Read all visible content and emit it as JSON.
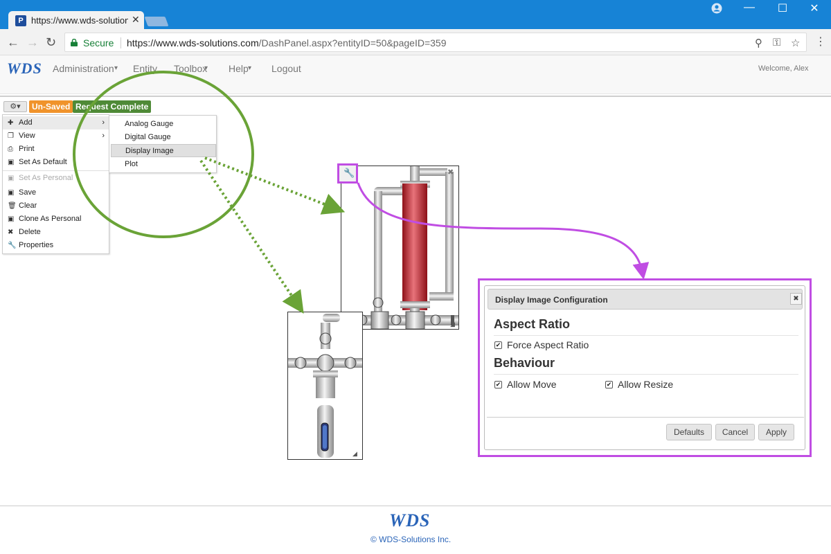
{
  "browser": {
    "tab_title": "https://www.wds-solution",
    "tab_close": "✕",
    "favicon_letter": "P",
    "secure_label": "Secure",
    "url_main": "https://www.wds-solutions.com",
    "url_path": "/DashPanel.aspx?entityID=50&pageID=359",
    "window_controls": {
      "minimize": "—",
      "maximize": "☐",
      "close": "✕"
    }
  },
  "app_nav": {
    "logo": "WDS",
    "items": [
      "Administration",
      "Entity",
      "Toolbox",
      "Help",
      "Logout"
    ],
    "dropdown_flags": [
      true,
      false,
      true,
      true,
      false
    ],
    "welcome": "Welcome, Alex"
  },
  "status": {
    "unsaved": "Un-Saved",
    "request_complete": "Request Complete"
  },
  "context_menu": {
    "items": [
      {
        "label": "Add",
        "icon": "plus-icon",
        "glyph": "✚",
        "submenu": true
      },
      {
        "label": "View",
        "icon": "window-icon",
        "glyph": "❐",
        "submenu": true
      },
      {
        "label": "Print",
        "icon": "print-icon",
        "glyph": "⎙"
      },
      {
        "label": "Set As Default",
        "icon": "save-icon",
        "glyph": "▣"
      },
      {
        "label": "Set As Personal",
        "icon": "save-icon",
        "glyph": "▣",
        "disabled": true
      },
      {
        "label": "Save",
        "icon": "save-icon",
        "glyph": "▣"
      },
      {
        "label": "Clear",
        "icon": "trash-icon",
        "glyph": "🗑"
      },
      {
        "label": "Clone As Personal",
        "icon": "save-icon",
        "glyph": "▣"
      },
      {
        "label": "Delete",
        "icon": "delete-icon",
        "glyph": "✖"
      },
      {
        "label": "Properties",
        "icon": "wrench-icon",
        "glyph": "🔧"
      }
    ]
  },
  "add_submenu": {
    "items": [
      "Analog Gauge",
      "Digital Gauge",
      "Display Image",
      "Plot"
    ],
    "highlighted": "Display Image"
  },
  "dialog": {
    "title": "Display Image Configuration",
    "close": "✖",
    "aspect_section": "Aspect Ratio",
    "force_aspect": "Force Aspect Ratio",
    "force_aspect_checked": true,
    "behaviour_section": "Behaviour",
    "allow_move": "Allow Move",
    "allow_move_checked": true,
    "allow_resize": "Allow Resize",
    "allow_resize_checked": true,
    "buttons": {
      "defaults": "Defaults",
      "cancel": "Cancel",
      "apply": "Apply"
    }
  },
  "footer": {
    "logo": "WDS",
    "copyright": "© WDS-Solutions Inc."
  },
  "colors": {
    "chrome_blue": "#1783d6",
    "annotation_green": "#6aa337",
    "annotation_purple": "#c04de3",
    "brand_blue": "#2a64b8",
    "unsaved_orange": "#f0932b",
    "complete_green": "#4f8a37",
    "vessel_red": "#c8202e"
  }
}
